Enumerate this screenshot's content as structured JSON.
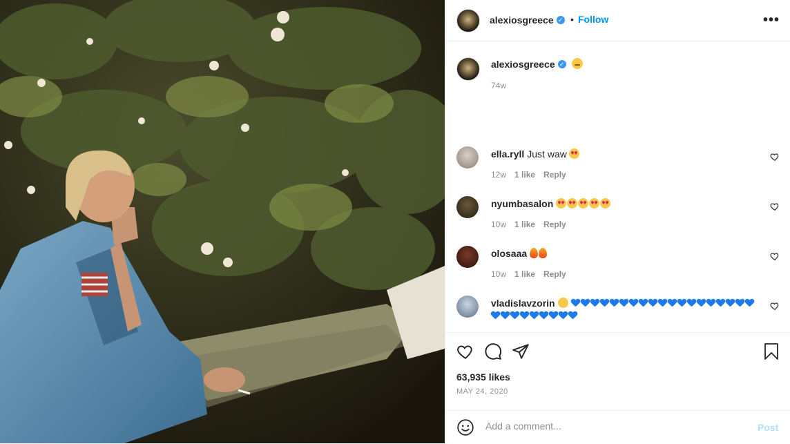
{
  "post": {
    "username": "alexiosgreece",
    "verified": true,
    "follow_label": "Follow",
    "separator": "•",
    "more_label": "•••",
    "caption": {
      "username": "alexiosgreece",
      "emoji": "smiling-face-emoji",
      "age": "74w"
    },
    "comments": [
      {
        "username": "ella.ryll",
        "text": "Just waw",
        "emoji": [
          "heart-eyes"
        ],
        "age": "12w",
        "likes": "1 like",
        "reply": "Reply"
      },
      {
        "username": "nyumbasalon",
        "text": "",
        "emoji": [
          "heart-eyes",
          "heart-eyes",
          "heart-eyes",
          "heart-eyes",
          "heart-eyes"
        ],
        "age": "10w",
        "likes": "1 like",
        "reply": "Reply"
      },
      {
        "username": "olosaaa",
        "text": "",
        "emoji": [
          "fire",
          "fire"
        ],
        "age": "10w",
        "likes": "1 like",
        "reply": "Reply"
      },
      {
        "username": "vladislavzorin",
        "text": "",
        "emoji": [
          "wink"
        ],
        "hearts": 28,
        "age": "",
        "likes": "",
        "reply": ""
      }
    ],
    "likes_count": "63,935 likes",
    "date": "MAY 24, 2020",
    "add_comment_placeholder": "Add a comment...",
    "post_button": "Post"
  },
  "colors": {
    "accent": "#0095f6",
    "verified": "#3897f0",
    "muted": "#8e8e8e",
    "post_disabled": "#b2dffc"
  }
}
